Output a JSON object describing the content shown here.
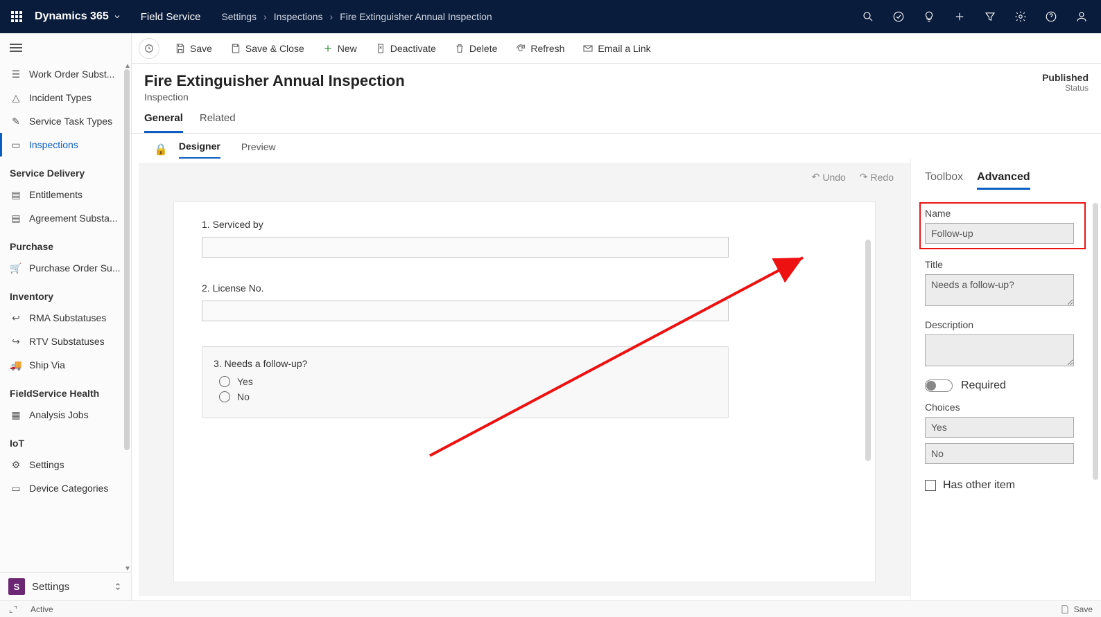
{
  "topnav": {
    "brand": "Dynamics 365",
    "app": "Field Service",
    "breadcrumb": [
      "Settings",
      "Inspections",
      "Fire Extinguisher Annual Inspection"
    ]
  },
  "sidebar": {
    "items_top": [
      {
        "label": "Work Order Subst..."
      },
      {
        "label": "Incident Types"
      },
      {
        "label": "Service Task Types"
      },
      {
        "label": "Inspections",
        "active": true
      }
    ],
    "groups": [
      {
        "header": "Service Delivery",
        "items": [
          {
            "label": "Entitlements"
          },
          {
            "label": "Agreement Substa..."
          }
        ]
      },
      {
        "header": "Purchase",
        "items": [
          {
            "label": "Purchase Order Su..."
          }
        ]
      },
      {
        "header": "Inventory",
        "items": [
          {
            "label": "RMA Substatuses"
          },
          {
            "label": "RTV Substatuses"
          },
          {
            "label": "Ship Via"
          }
        ]
      },
      {
        "header": "FieldService Health",
        "items": [
          {
            "label": "Analysis Jobs"
          }
        ]
      },
      {
        "header": "IoT",
        "items": [
          {
            "label": "Settings"
          },
          {
            "label": "Device Categories"
          }
        ]
      }
    ],
    "area": {
      "badge": "S",
      "name": "Settings"
    }
  },
  "cmdbar": {
    "save": "Save",
    "saveclose": "Save & Close",
    "new": "New",
    "deactivate": "Deactivate",
    "delete": "Delete",
    "refresh": "Refresh",
    "emaillink": "Email a Link"
  },
  "record": {
    "title": "Fire Extinguisher Annual Inspection",
    "entity": "Inspection",
    "status_value": "Published",
    "status_label": "Status"
  },
  "tabs": {
    "general": "General",
    "related": "Related"
  },
  "subtabs": {
    "designer": "Designer",
    "preview": "Preview"
  },
  "canvas": {
    "undo": "Undo",
    "redo": "Redo",
    "q1": "1. Serviced by",
    "q2": "2. License No.",
    "q3": "3. Needs a follow-up?",
    "opt_yes": "Yes",
    "opt_no": "No"
  },
  "sidepanel": {
    "toolbox": "Toolbox",
    "advanced": "Advanced",
    "name_label": "Name",
    "name_value": "Follow-up",
    "title_label": "Title",
    "title_value": "Needs a follow-up?",
    "desc_label": "Description",
    "desc_value": "",
    "required": "Required",
    "choices": "Choices",
    "choice1": "Yes",
    "choice2": "No",
    "has_other": "Has other item"
  },
  "statusbar": {
    "active": "Active",
    "save": "Save"
  }
}
